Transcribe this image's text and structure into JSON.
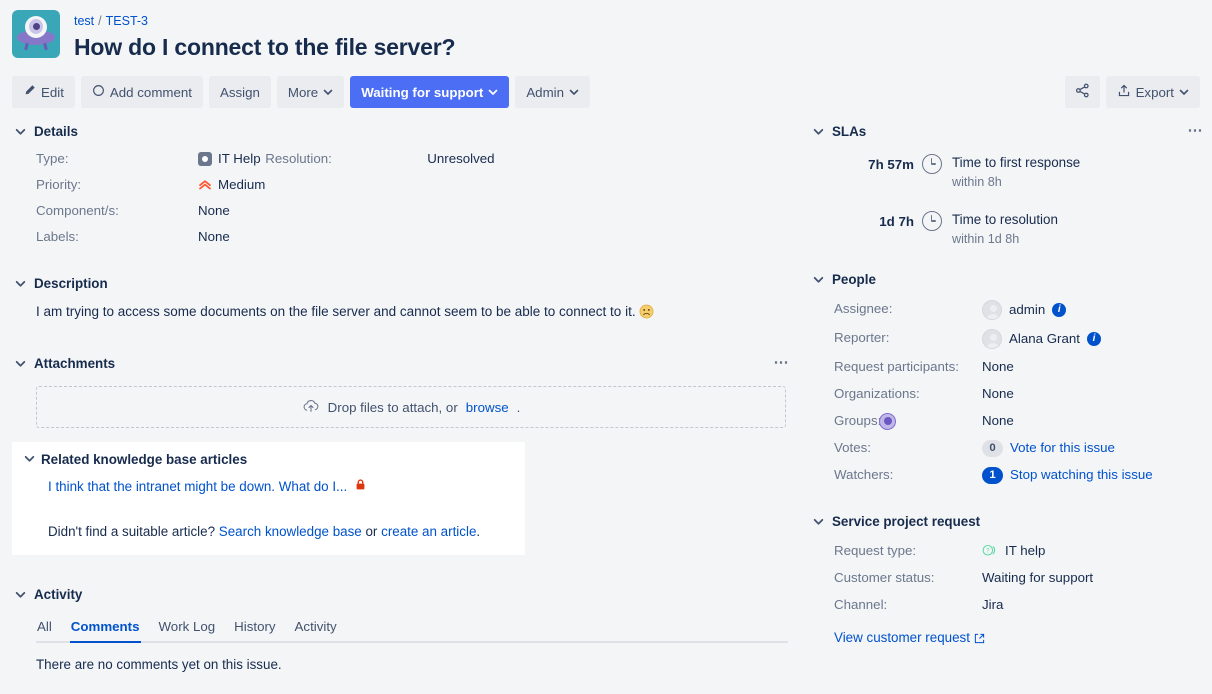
{
  "header": {
    "breadcrumb_project": "test",
    "breadcrumb_issue": "TEST-3",
    "breadcrumb_separator": "/",
    "title": "How do I connect to the file server?",
    "avatar_name": "ufo-project-avatar"
  },
  "toolbar": {
    "edit": "Edit",
    "add_comment": "Add comment",
    "assign": "Assign",
    "more": "More",
    "status": "Waiting for support",
    "admin": "Admin",
    "export": "Export",
    "share_icon": "share-icon",
    "chevron": "⌵"
  },
  "details": {
    "section_title": "Details",
    "rows_left": [
      {
        "label": "Type:",
        "value": "IT Help",
        "icon": "it-help-type-icon"
      },
      {
        "label": "Priority:",
        "value": "Medium",
        "icon": "priority-medium-icon"
      },
      {
        "label": "Component/s:",
        "value": "None",
        "icon": ""
      },
      {
        "label": "Labels:",
        "value": "None",
        "icon": ""
      }
    ],
    "rows_right": [
      {
        "label": "Resolution:",
        "value": "Unresolved"
      }
    ]
  },
  "description": {
    "section_title": "Description",
    "text": "I am trying to access some documents on the file server and cannot seem to be able to connect to it.",
    "emoji": "☹"
  },
  "attachments": {
    "section_title": "Attachments",
    "dropzone_text": "Drop files to attach, or",
    "browse_link": "browse",
    "trailing_period": ".",
    "more_icon": "more-options-icon"
  },
  "knowledge_base": {
    "section_title": "Related knowledge base articles",
    "article_title": "I think that the intranet might be down. What do I...",
    "lock_icon": "restricted-lock-icon",
    "footer_prefix": "Didn't find a suitable article?",
    "search_link": "Search knowledge base",
    "footer_or": "or",
    "create_link": "create an article",
    "footer_suffix": "."
  },
  "activity": {
    "section_title": "Activity",
    "tabs": [
      {
        "label": "All",
        "active": false
      },
      {
        "label": "Comments",
        "active": true
      },
      {
        "label": "Work Log",
        "active": false
      },
      {
        "label": "History",
        "active": false
      },
      {
        "label": "Activity",
        "active": false
      }
    ],
    "empty_text": "There are no comments yet on this issue."
  },
  "slas": {
    "section_title": "SLAs",
    "more_icon": "more-options-icon",
    "items": [
      {
        "time": "7h 57m",
        "name": "Time to first response",
        "goal": "within 8h",
        "icon": "clock-icon"
      },
      {
        "time": "1d 7h",
        "name": "Time to resolution",
        "goal": "within 1d 8h",
        "icon": "clock-icon"
      }
    ]
  },
  "people": {
    "section_title": "People",
    "assignee_label": "Assignee:",
    "assignee_value": "admin",
    "reporter_label": "Reporter:",
    "reporter_value": "Alana Grant",
    "participants_label": "Request participants:",
    "participants_value": "None",
    "organizations_label": "Organizations:",
    "organizations_value": "None",
    "groups_label": "Groups:",
    "groups_value": "None",
    "votes_label": "Votes:",
    "votes_count": "0",
    "votes_link": "Vote for this issue",
    "watchers_label": "Watchers:",
    "watchers_count": "1",
    "watchers_link": "Stop watching this issue"
  },
  "service_request": {
    "section_title": "Service project request",
    "request_type_label": "Request type:",
    "request_type_value": "IT help",
    "request_type_icon": "question-bubble-icon",
    "customer_status_label": "Customer status:",
    "customer_status_value": "Waiting for support",
    "channel_label": "Channel:",
    "channel_value": "Jira",
    "view_link": "View customer request",
    "external_icon": "external-link-icon"
  },
  "colors": {
    "page_bg": "#f4f5f7",
    "link": "#0052cc",
    "primary_button": "#4c6ef5",
    "text": "#172b4d",
    "muted": "#6b778c",
    "avatar_bg": "#3aa7b8",
    "priority_medium": "#ff5630",
    "lock_red": "#de350b"
  }
}
